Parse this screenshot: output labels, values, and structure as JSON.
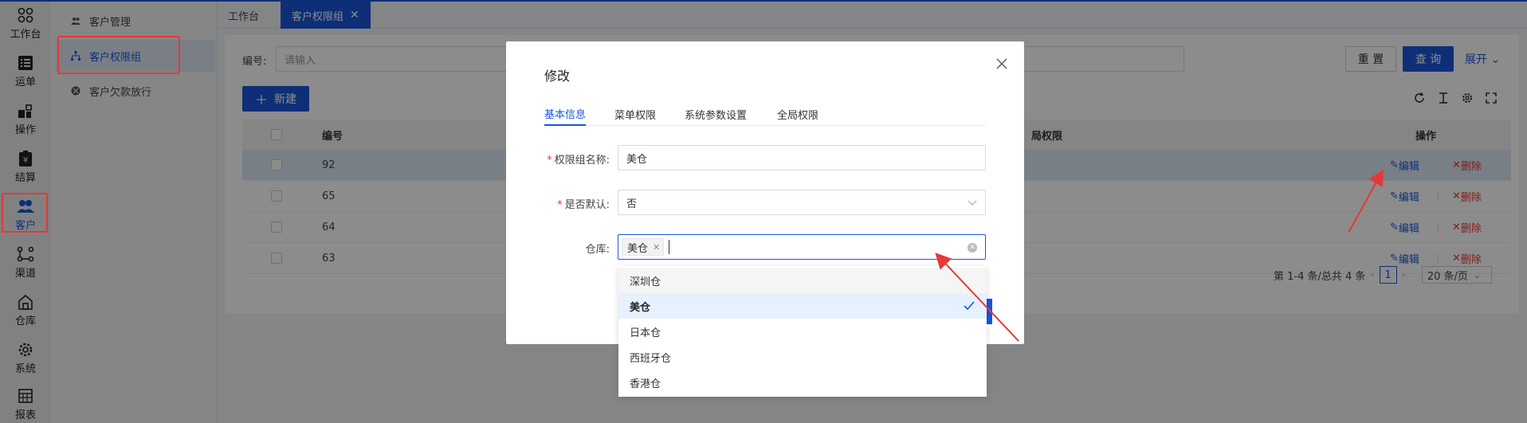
{
  "rail": {
    "items": [
      {
        "label": "工作台",
        "icon": "workbench-icon"
      },
      {
        "label": "运单",
        "icon": "list-icon"
      },
      {
        "label": "操作",
        "icon": "operate-icon"
      },
      {
        "label": "结算",
        "icon": "settle-icon"
      },
      {
        "label": "客户",
        "icon": "users-icon"
      },
      {
        "label": "渠道",
        "icon": "channel-icon"
      },
      {
        "label": "仓库",
        "icon": "warehouse-icon"
      },
      {
        "label": "系统",
        "icon": "gear-icon"
      },
      {
        "label": "报表",
        "icon": "report-icon"
      }
    ]
  },
  "subnav": {
    "items": [
      {
        "label": "客户管理"
      },
      {
        "label": "客户权限组"
      },
      {
        "label": "客户欠款放行"
      }
    ]
  },
  "tabs": {
    "workbench": "工作台",
    "active": "客户权限组"
  },
  "filter": {
    "number_label": "编号:",
    "number_placeholder": "请输入"
  },
  "buttons": {
    "reset": "重 置",
    "query": "查 询",
    "expand": "展开",
    "new": "新建"
  },
  "table": {
    "headers": {
      "id": "编号",
      "menu_perm": "局权限",
      "ops": "操作"
    },
    "rows": [
      {
        "id": "92"
      },
      {
        "id": "65"
      },
      {
        "id": "64"
      },
      {
        "id": "63"
      }
    ],
    "edit": "编辑",
    "delete": "删除"
  },
  "pager": {
    "summary": "第 1-4 条/总共 4 条",
    "page": "1",
    "size": "20 条/页"
  },
  "modal": {
    "title": "修改",
    "tabs": [
      "基本信息",
      "菜单权限",
      "系统参数设置",
      "全局权限"
    ],
    "fields": {
      "name_label": "权限组名称:",
      "name_value": "美仓",
      "default_label": "是否默认:",
      "default_value": "否",
      "warehouse_label": "仓库:",
      "warehouse_tag": "美仓"
    },
    "options": [
      "深圳仓",
      "美仓",
      "日本仓",
      "西班牙仓",
      "香港仓"
    ]
  },
  "colors": {
    "accent": "#1a56db",
    "danger": "#e53935",
    "annotation": "#e53935"
  }
}
